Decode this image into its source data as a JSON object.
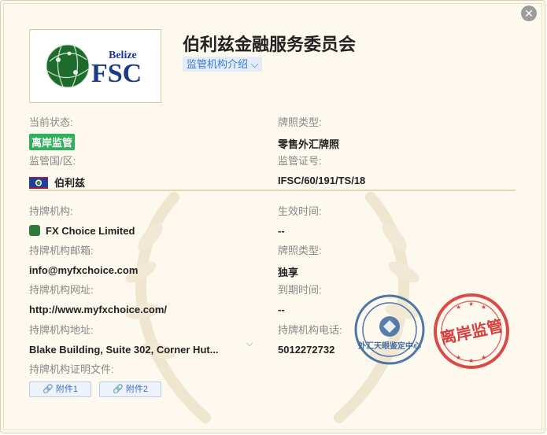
{
  "header": {
    "title": "伯利兹金融服务委员会",
    "intro_label": "监管机构介绍 ⌵",
    "logo_small": "Belize",
    "logo_big": "FSC"
  },
  "fields": {
    "status_label": "当前状态:",
    "status_value": "离岸监管",
    "license_type_label": "牌照类型:",
    "license_type_value": "零售外汇牌照",
    "region_label": "监管国/区:",
    "region_value": "伯利兹",
    "license_no_label": "监管证号:",
    "license_no_value": "IFSC/60/191/TS/18",
    "holder_label": "持牌机构:",
    "holder_value": "FX Choice Limited",
    "effective_label": "生效时间:",
    "effective_value": "--",
    "email_label": "持牌机构邮箱:",
    "email_value": "info@myfxchoice.com",
    "license_type2_label": "牌照类型:",
    "license_type2_value": "独享",
    "website_label": "持牌机构网址:",
    "website_value": "http://www.myfxchoice.com/",
    "expire_label": "到期时间:",
    "expire_value": "--",
    "address_label": "持牌机构地址:",
    "address_value": "Blake Building, Suite 302, Corner Hut...",
    "phone_label": "持牌机构电话:",
    "phone_value": "5012272732",
    "cert_label": "持牌机构证明文件:",
    "attachment1": "🔗 附件1",
    "attachment2": "🔗 附件2"
  },
  "stamps": {
    "blue_text": "外汇天眼鉴定中心",
    "red_text": "离岸监管"
  },
  "colors": {
    "badge_green": "#2fb05a",
    "link_blue": "#3a7bd5",
    "stamp_blue": "#2f5f9c",
    "stamp_red": "#d32b2b"
  }
}
